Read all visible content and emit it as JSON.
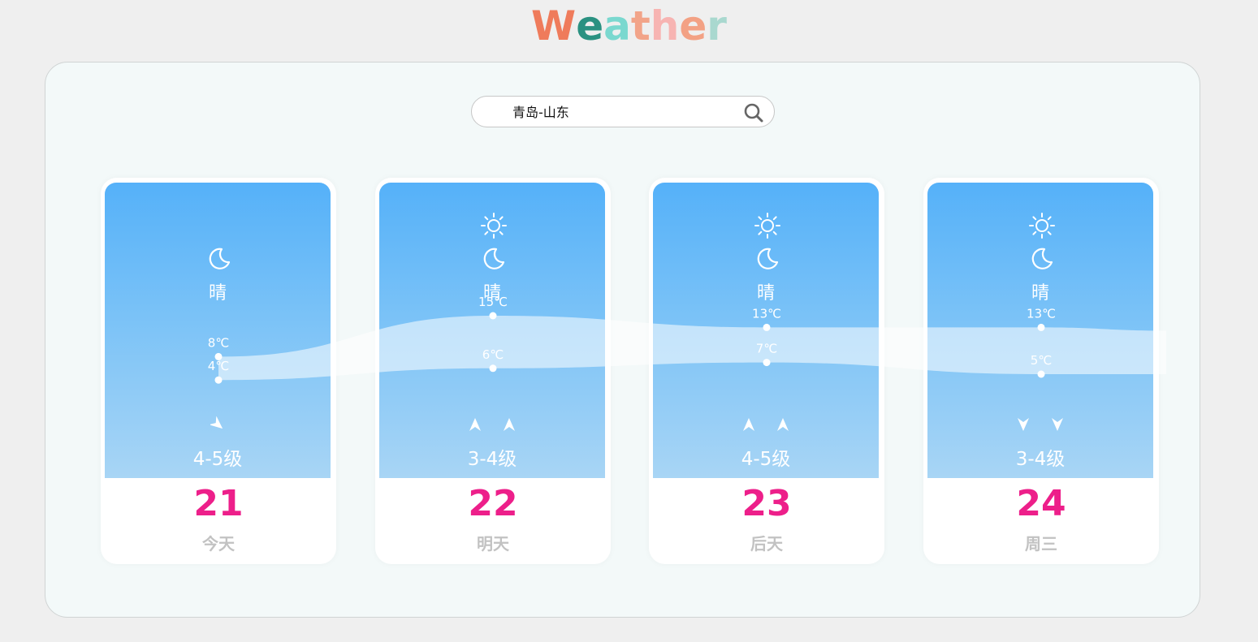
{
  "app": {
    "title_letters": [
      {
        "ch": "W",
        "color": "#ef7b5b"
      },
      {
        "ch": "e",
        "color": "#2a9181"
      },
      {
        "ch": "a",
        "color": "#7ad8cf"
      },
      {
        "ch": "t",
        "color": "#f2a489"
      },
      {
        "ch": "h",
        "color": "#f7b4b2"
      },
      {
        "ch": "e",
        "color": "#f3a184"
      },
      {
        "ch": "r",
        "color": "#a9d8cf"
      }
    ]
  },
  "search": {
    "value": "青岛-山东",
    "icon": "search-icon"
  },
  "colors": {
    "date": "#ed1f8a",
    "day": "#c2c2c2",
    "sky_top": "#55b1f9",
    "sky_bottom": "#a8d5f5"
  },
  "forecast": [
    {
      "date": "21",
      "day": "今天",
      "condition": "晴",
      "high": "8℃",
      "low": "4℃",
      "high_value": 8,
      "low_value": 4,
      "wind_level": "4-5级",
      "show_sun": false,
      "wind_icons": [
        "wind-direction-southeast-icon"
      ]
    },
    {
      "date": "22",
      "day": "明天",
      "condition": "晴",
      "high": "15℃",
      "low": "6℃",
      "high_value": 15,
      "low_value": 6,
      "wind_level": "3-4级",
      "show_sun": true,
      "wind_icons": [
        "wind-north-icon",
        "wind-north-icon"
      ]
    },
    {
      "date": "23",
      "day": "后天",
      "condition": "晴",
      "high": "13℃",
      "low": "7℃",
      "high_value": 13,
      "low_value": 7,
      "wind_level": "4-5级",
      "show_sun": true,
      "wind_icons": [
        "wind-north-icon",
        "wind-north-icon"
      ]
    },
    {
      "date": "24",
      "day": "周三",
      "condition": "晴",
      "high": "13℃",
      "low": "5℃",
      "high_value": 13,
      "low_value": 5,
      "wind_level": "3-4级",
      "show_sun": true,
      "wind_icons": [
        "wind-south-icon",
        "wind-south-icon"
      ]
    }
  ]
}
